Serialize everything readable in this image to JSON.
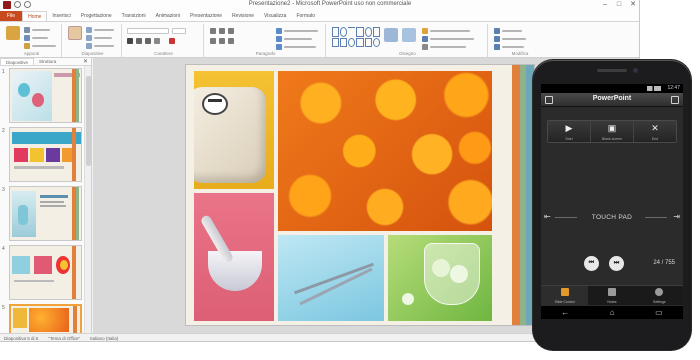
{
  "window": {
    "title": "Presentazione2 - Microsoft PowerPoint uso non commerciale",
    "controls": [
      "–",
      "□",
      "✕"
    ]
  },
  "ribbon": {
    "tabs": [
      "File",
      "Home",
      "Inserisci",
      "Progettazione",
      "Transizioni",
      "Animazioni",
      "Presentazione",
      "Revisione",
      "Visualizza",
      "Formato"
    ],
    "active_tab": "Home",
    "groups": [
      "Appunti",
      "Diapositive",
      "Carattere",
      "Paragrafo",
      "Disegno",
      "Modifica"
    ]
  },
  "slides_pane": {
    "tabs": [
      "Diapositive",
      "Struttura"
    ],
    "close": "✕",
    "numbers": [
      "1",
      "2",
      "3",
      "4",
      "5"
    ],
    "selected": 5
  },
  "status": {
    "slide": "Diapositiva 5 di 5",
    "theme": "\"Tema di Office\"",
    "language": "Italiano (Italia)"
  },
  "phone": {
    "status_clock": "12:47",
    "app_title": "PowerPoint",
    "controls": [
      {
        "icon": "▶",
        "label": "Start"
      },
      {
        "icon": "▣",
        "label": "Blank screen"
      },
      {
        "icon": "✕",
        "label": "End"
      }
    ],
    "touch_pad_label": "TOUCH PAD",
    "prev": "⏮",
    "next": "⏭",
    "time": "24 / 755",
    "bottom_tabs": [
      "Slide Control",
      "Notes",
      "Settings"
    ],
    "sys_nav": [
      "←",
      "⌂",
      "▭"
    ]
  },
  "colors": {
    "accent": "#c74b1e",
    "selected_thumb": "#f0a33b",
    "stripe_orange": "#e0803a",
    "stripe_green": "#8fb28a",
    "stripe_teal": "#6ea7b7"
  }
}
